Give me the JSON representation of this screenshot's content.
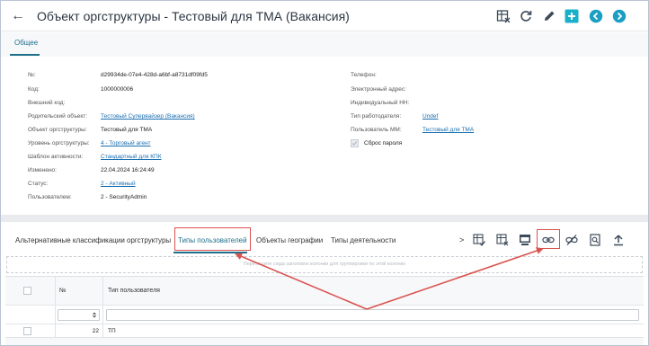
{
  "header": {
    "title": "Объект оргструктуры - Тестовый для ТМА (Вакансия)",
    "icons": [
      "back-arrow-icon",
      "columns-settings-icon",
      "refresh-icon",
      "edit-pencil-icon",
      "add-plus-icon",
      "prev-record-icon",
      "next-record-icon"
    ]
  },
  "tabs_top": {
    "general": "Общее"
  },
  "form": {
    "left": [
      {
        "label": "№:",
        "value": "d29934de-07e4-428d-a6bf-a8731df09fd5",
        "link": false
      },
      {
        "label": "Код:",
        "value": "1000000006",
        "link": false
      },
      {
        "label": "Внешний код:",
        "value": "",
        "link": false
      },
      {
        "label": "Родительский объект:",
        "value": "Тестовый Супервайзер (Вакансия)",
        "link": true
      },
      {
        "label": "Объект оргструктуры:",
        "value": "Тестовый для ТМА",
        "link": false
      },
      {
        "label": "Уровень оргструктуры:",
        "value": "4 - Торговый агент",
        "link": true
      },
      {
        "label": "Шаблон активности:",
        "value": "Стандартный для КПК",
        "link": true
      },
      {
        "label": "Изменено:",
        "value": "22.04.2024 16:24:49",
        "link": false
      },
      {
        "label": "Статус:",
        "value": "2 - Активный",
        "link": true
      },
      {
        "label": "Пользователем:",
        "value": "2 - SecurityAdmin",
        "link": false
      }
    ],
    "right": [
      {
        "label": "Телефон:",
        "value": "",
        "link": false
      },
      {
        "label": "Электронный адрес:",
        "value": "",
        "link": false
      },
      {
        "label": "Индивидуальный НН:",
        "value": "",
        "link": false
      },
      {
        "label": "Тип работодателя:",
        "value": "Undef",
        "link": true
      },
      {
        "label": "Пользователь ММ:",
        "value": "Тестовый для ТМА",
        "link": true
      }
    ],
    "reset_password_label": "Сброс пароля"
  },
  "tabs_bottom": {
    "items": [
      "Альтернативные классификации оргструктуры",
      "Типы пользователей",
      "Объекты географии",
      "Типы деятельности"
    ],
    "active_index": 1,
    "more": ">"
  },
  "toolbar_bottom": {
    "icons": [
      "select-column-icon",
      "columns-settings-icon",
      "table-export-icon",
      "link-icon",
      "unlink-icon",
      "preview-document-icon",
      "upload-icon"
    ]
  },
  "group_hint": "Перетащите сюда заголовок колонки для группировки по этой колонке",
  "grid": {
    "columns": [
      "№",
      "Тип пользователя"
    ],
    "rows": [
      {
        "num": "22",
        "type": "ТП"
      }
    ]
  },
  "colors": {
    "accent": "#1f6f8b",
    "link": "#1a6fb0",
    "annotation": "#d9534f",
    "add_button": "#1ab0c9"
  }
}
